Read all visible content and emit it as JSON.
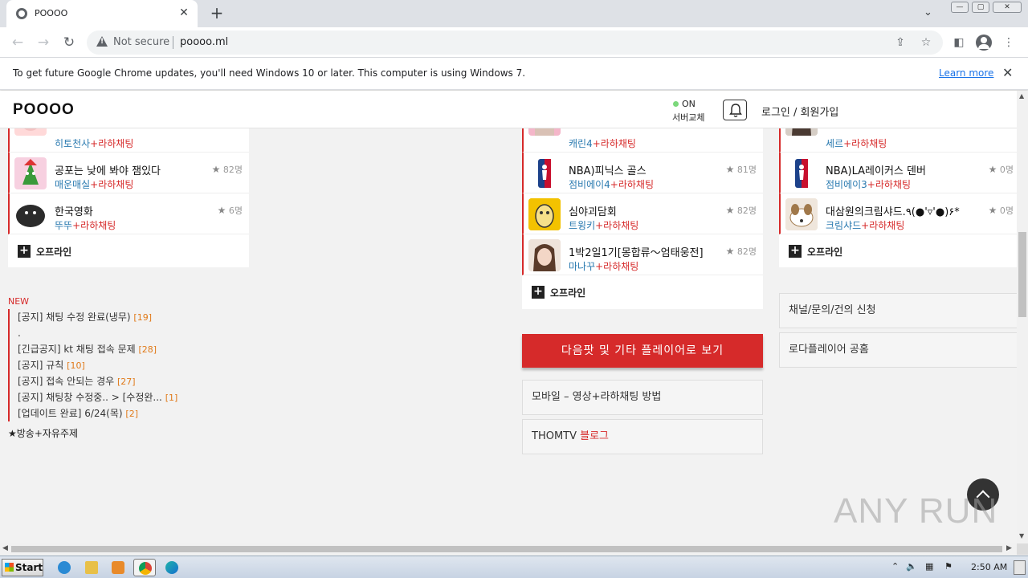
{
  "browser": {
    "tab_title": "POOOO",
    "tab_close": "✕",
    "new_tab": "+",
    "security_label": "Not secure",
    "url": "poooo.ml",
    "infobar_text": "To get future Google Chrome updates, you'll need Windows 10 or later. This computer is using Windows 7.",
    "infobar_link": "Learn more",
    "infobar_close": "✕"
  },
  "site": {
    "logo": "POOOO",
    "server_status": "ON",
    "server_label": "서버교체",
    "login_label": "로그인 / 회원가입"
  },
  "left_card": {
    "rows": [
      {
        "title": "",
        "name": "히토천사",
        "tag": "+라하채팅",
        "viewers": ""
      },
      {
        "title": "공포는 낮에 봐야 잼있다",
        "name": "매운매실",
        "tag": "+라하채팅",
        "viewers": "82명"
      },
      {
        "title": "한국영화",
        "name": "뚜뚜",
        "tag": "+라하채팅",
        "viewers": "6명"
      }
    ],
    "offline_label": "오프라인"
  },
  "mid_card": {
    "rows": [
      {
        "title": "",
        "name": "캐린4",
        "tag": "+라하채팅",
        "viewers": ""
      },
      {
        "title": "NBA)피닉스 골스",
        "name": "점비에이4",
        "tag": "+라하채팅",
        "viewers": "81명"
      },
      {
        "title": "심야괴담회",
        "name": "트윙키",
        "tag": "+라하채팅",
        "viewers": "82명"
      },
      {
        "title": "1박2일1기[몽합류～엄태웅전]",
        "name": "마나꾸",
        "tag": "+라하채팅",
        "viewers": "82명"
      }
    ],
    "offline_label": "오프라인"
  },
  "right_card": {
    "rows": [
      {
        "title": "",
        "name": "세르",
        "tag": "+라하채팅",
        "viewers": ""
      },
      {
        "title": "NBA)LA레이커스 덴버",
        "name": "점비에이3",
        "tag": "+라하채팅",
        "viewers": "0명"
      },
      {
        "title": "대삼원의크림샤드.٩(●'▿'●)۶*",
        "name": "크림샤드",
        "tag": "+라하채팅",
        "viewers": "0명"
      }
    ],
    "offline_label": "오프라인"
  },
  "new_section": {
    "label": "NEW",
    "notices": [
      {
        "text": "[공지] 채팅 수정 완료(냉무)",
        "count": "[19]"
      },
      {
        "text": ".",
        "count": ""
      },
      {
        "text": "[긴급공지] kt 채팅 접속 문제",
        "count": "[28]"
      },
      {
        "text": "[공지] 규칙",
        "count": "[10]"
      },
      {
        "text": "[공지] 접속 안되는 경우",
        "count": "[27]"
      },
      {
        "text": "[공지] 채팅창 수정중.. > [수정완...",
        "count": "[1]"
      },
      {
        "text": "[업데이트 완료] 6/24(목)",
        "count": "[2]"
      }
    ],
    "broadcast_label": "★방송+자유주제"
  },
  "mid_buttons": {
    "more_players": "다음팟 및 기타 플레이어로 보기",
    "mobile_guide": "모바일 – 영상+라하채팅 방법",
    "blog_prefix": "THOMTV",
    "blog_suffix": "블로그"
  },
  "right_buttons": {
    "channel_request": "채널/문의/건의 신청",
    "promo": "로다플레이어 공홈"
  },
  "watermark": "ANY RUN",
  "taskbar": {
    "start_label": "Start",
    "clock": "2:50 AM"
  },
  "colors": {
    "accent_red": "#d62a2a",
    "link_blue": "#2a7ab0",
    "count_orange": "#e07a1a",
    "chrome_link": "#1a73e8"
  }
}
